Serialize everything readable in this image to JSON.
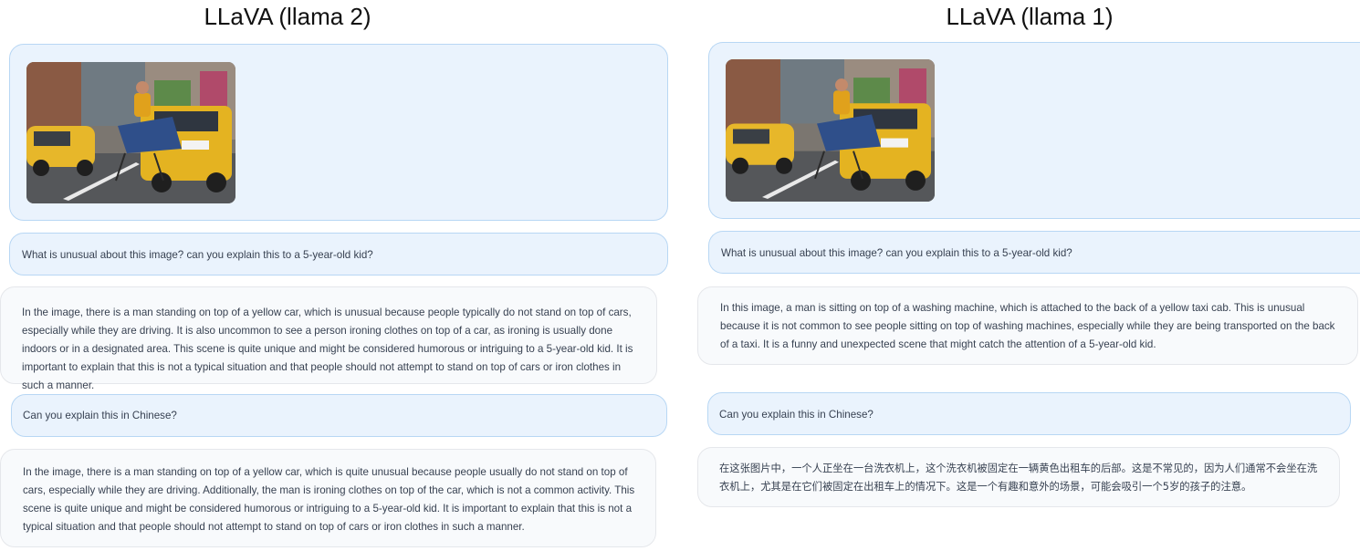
{
  "left": {
    "title": "LLaVA (llama 2)",
    "image_alt": "man ironing clothes on back of yellow taxi",
    "question1": "What is unusual about this image? can you explain this to a 5-year-old kid?",
    "answer1": "In the image, there is a man standing on top of a yellow car, which is unusual because people typically do not stand on top of cars, especially while they are driving. It is also uncommon to see a person ironing clothes on top of a car, as ironing is usually done indoors or in a designated area. This scene is quite unique and might be considered humorous or intriguing to a 5-year-old kid. It is important to explain that this is not a typical situation and that people should not attempt to stand on top of cars or iron clothes in such a manner.",
    "question2": "Can you explain this in Chinese?",
    "answer2": "In the image, there is a man standing on top of a yellow car, which is quite unusual because people usually do not stand on top of cars, especially while they are driving. Additionally, the man is ironing clothes on top of the car, which is not a common activity. This scene is quite unique and might be considered humorous or intriguing to a 5-year-old kid. It is important to explain that this is not a typical situation and that people should not attempt to stand on top of cars or iron clothes in such a manner."
  },
  "right": {
    "title": "LLaVA (llama 1)",
    "image_alt": "man ironing clothes on back of yellow taxi",
    "question1": "What is unusual about this image? can you explain this to a 5-year-old kid?",
    "answer1": "In this image, a man is sitting on top of a washing machine, which is attached to the back of a yellow taxi cab. This is unusual because it is not common to see people sitting on top of washing machines, especially while they are being transported on the back of a taxi. It is a funny and unexpected scene that might catch the attention of a 5-year-old kid.",
    "question2": "Can you explain this in Chinese?",
    "answer2": "在这张图片中，一个人正坐在一台洗衣机上，这个洗衣机被固定在一辆黄色出租车的后部。这是不常见的，因为人们通常不会坐在洗衣机上，尤其是在它们被固定在出租车上的情况下。这是一个有趣和意外的场景，可能会吸引一个5岁的孩子的注意。"
  }
}
